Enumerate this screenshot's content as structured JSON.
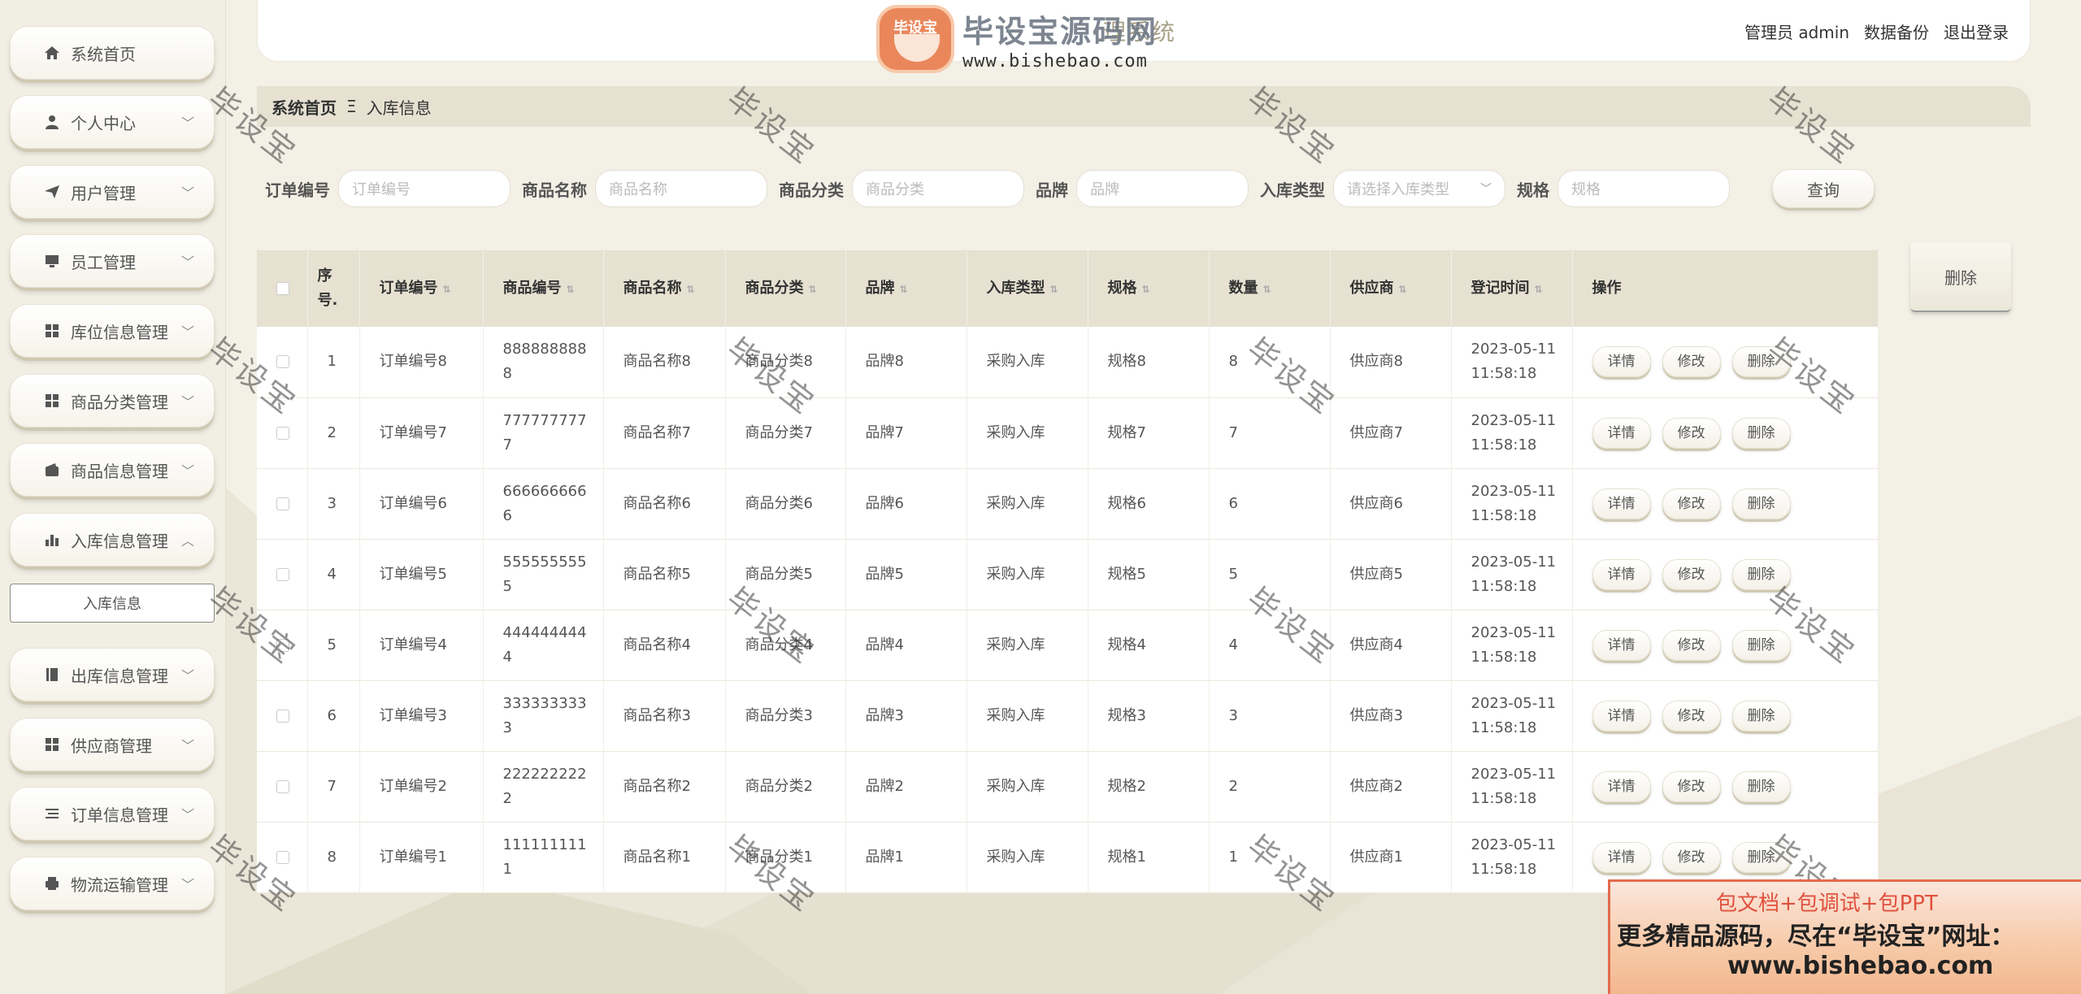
{
  "header": {
    "title": "理系统",
    "user_label": "管理员 admin",
    "backup_label": "数据备份",
    "logout_label": "退出登录"
  },
  "logo_watermark": {
    "badge_text": "毕设宝",
    "main_text": "毕设宝源码网",
    "url_text": "www.bishebao.com"
  },
  "sidebar": {
    "items": [
      {
        "label": "系统首页",
        "icon": "home-icon",
        "has_chevron": false
      },
      {
        "label": "个人中心",
        "icon": "person-icon",
        "has_chevron": true
      },
      {
        "label": "用户管理",
        "icon": "send-icon",
        "has_chevron": true
      },
      {
        "label": "员工管理",
        "icon": "monitor-icon",
        "has_chevron": true
      },
      {
        "label": "库位信息管理",
        "icon": "grid-icon",
        "has_chevron": true
      },
      {
        "label": "商品分类管理",
        "icon": "grid-icon",
        "has_chevron": true
      },
      {
        "label": "商品信息管理",
        "icon": "wallet-icon",
        "has_chevron": true
      },
      {
        "label": "入库信息管理",
        "icon": "bar-chart-icon",
        "has_chevron": true,
        "expanded": true
      },
      {
        "label": "出库信息管理",
        "icon": "book-icon",
        "has_chevron": true
      },
      {
        "label": "供应商管理",
        "icon": "grid-icon",
        "has_chevron": true
      },
      {
        "label": "订单信息管理",
        "icon": "list-icon",
        "has_chevron": true
      },
      {
        "label": "物流运输管理",
        "icon": "printer-icon",
        "has_chevron": true
      }
    ],
    "submenu": {
      "label": "入库信息"
    }
  },
  "breadcrumb": {
    "home": "系统首页",
    "separator": "Ξ",
    "current": "入库信息"
  },
  "search": {
    "fields": [
      {
        "label": "订单编号",
        "placeholder": "订单编号"
      },
      {
        "label": "商品名称",
        "placeholder": "商品名称"
      },
      {
        "label": "商品分类",
        "placeholder": "商品分类"
      },
      {
        "label": "品牌",
        "placeholder": "品牌"
      },
      {
        "label": "入库类型",
        "placeholder": "请选择入库类型",
        "select": true
      },
      {
        "label": "规格",
        "placeholder": "规格"
      }
    ],
    "query_label": "查询"
  },
  "actions": {
    "delete_label": "删除"
  },
  "table": {
    "headers": [
      "序号.",
      "订单编号",
      "商品编号",
      "商品名称",
      "商品分类",
      "品牌",
      "入库类型",
      "规格",
      "数量",
      "供应商",
      "登记时间",
      "操作"
    ],
    "op_labels": [
      "详情",
      "修改",
      "删除"
    ],
    "rows": [
      {
        "idx": "1",
        "order": "订单编号8",
        "code": "8888888888",
        "name": "商品名称8",
        "cat": "商品分类8",
        "brand": "品牌8",
        "type": "采购入库",
        "spec": "规格8",
        "qty": "8",
        "supplier": "供应商8",
        "time": "2023-05-11 11:58:18"
      },
      {
        "idx": "2",
        "order": "订单编号7",
        "code": "7777777777",
        "name": "商品名称7",
        "cat": "商品分类7",
        "brand": "品牌7",
        "type": "采购入库",
        "spec": "规格7",
        "qty": "7",
        "supplier": "供应商7",
        "time": "2023-05-11 11:58:18"
      },
      {
        "idx": "3",
        "order": "订单编号6",
        "code": "6666666666",
        "name": "商品名称6",
        "cat": "商品分类6",
        "brand": "品牌6",
        "type": "采购入库",
        "spec": "规格6",
        "qty": "6",
        "supplier": "供应商6",
        "time": "2023-05-11 11:58:18"
      },
      {
        "idx": "4",
        "order": "订单编号5",
        "code": "5555555555",
        "name": "商品名称5",
        "cat": "商品分类5",
        "brand": "品牌5",
        "type": "采购入库",
        "spec": "规格5",
        "qty": "5",
        "supplier": "供应商5",
        "time": "2023-05-11 11:58:18"
      },
      {
        "idx": "5",
        "order": "订单编号4",
        "code": "4444444444",
        "name": "商品名称4",
        "cat": "商品分类4",
        "brand": "品牌4",
        "type": "采购入库",
        "spec": "规格4",
        "qty": "4",
        "supplier": "供应商4",
        "time": "2023-05-11 11:58:18"
      },
      {
        "idx": "6",
        "order": "订单编号3",
        "code": "3333333333",
        "name": "商品名称3",
        "cat": "商品分类3",
        "brand": "品牌3",
        "type": "采购入库",
        "spec": "规格3",
        "qty": "3",
        "supplier": "供应商3",
        "time": "2023-05-11 11:58:18"
      },
      {
        "idx": "7",
        "order": "订单编号2",
        "code": "2222222222",
        "name": "商品名称2",
        "cat": "商品分类2",
        "brand": "品牌2",
        "type": "采购入库",
        "spec": "规格2",
        "qty": "2",
        "supplier": "供应商2",
        "time": "2023-05-11 11:58:18"
      },
      {
        "idx": "8",
        "order": "订单编号1",
        "code": "1111111111",
        "name": "商品名称1",
        "cat": "商品分类1",
        "brand": "品牌1",
        "type": "采购入库",
        "spec": "规格1",
        "qty": "1",
        "supplier": "供应商1",
        "time": "2023-05-11 11:58:18"
      }
    ]
  },
  "watermark_text": "毕设宝",
  "ad": {
    "line1": "包文档+包调试+包PPT",
    "line2": "更多精品源码，尽在“毕设宝”网址：",
    "line3": "www.bishebao.com"
  },
  "colors": {
    "background": "#f3f0e6",
    "sidebar": "#f1eee3",
    "header_band": "#e6e1d1",
    "ad_accent": "#e0513e"
  }
}
